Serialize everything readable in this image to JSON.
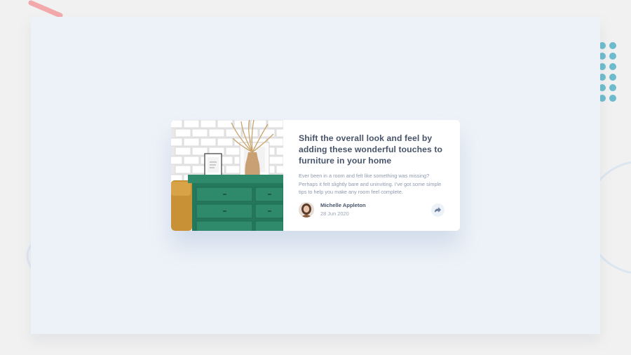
{
  "article": {
    "title": "Shift the overall look and feel by adding these wonderful touches to furniture in your home",
    "excerpt": "Ever been in a room and felt like something was missing? Perhaps it felt slightly bare and uninviting. I’ve got some simple tips to help you make any room feel complete.",
    "author": {
      "name": "Michelle Appleton",
      "date": "28 Jun 2020"
    },
    "image_icon": "drawers-photo",
    "share_icon": "share-icon"
  },
  "colors": {
    "page_background": "#f1f1f1",
    "stage_background": "#edf2f8",
    "card_background": "#ffffff",
    "heading_text": "#48556a",
    "body_text": "#8f9aaf",
    "accent_dots": "#6cbcce",
    "accent_stroke": "#f3a8ab",
    "drawer_green": "#2f8a6c"
  }
}
